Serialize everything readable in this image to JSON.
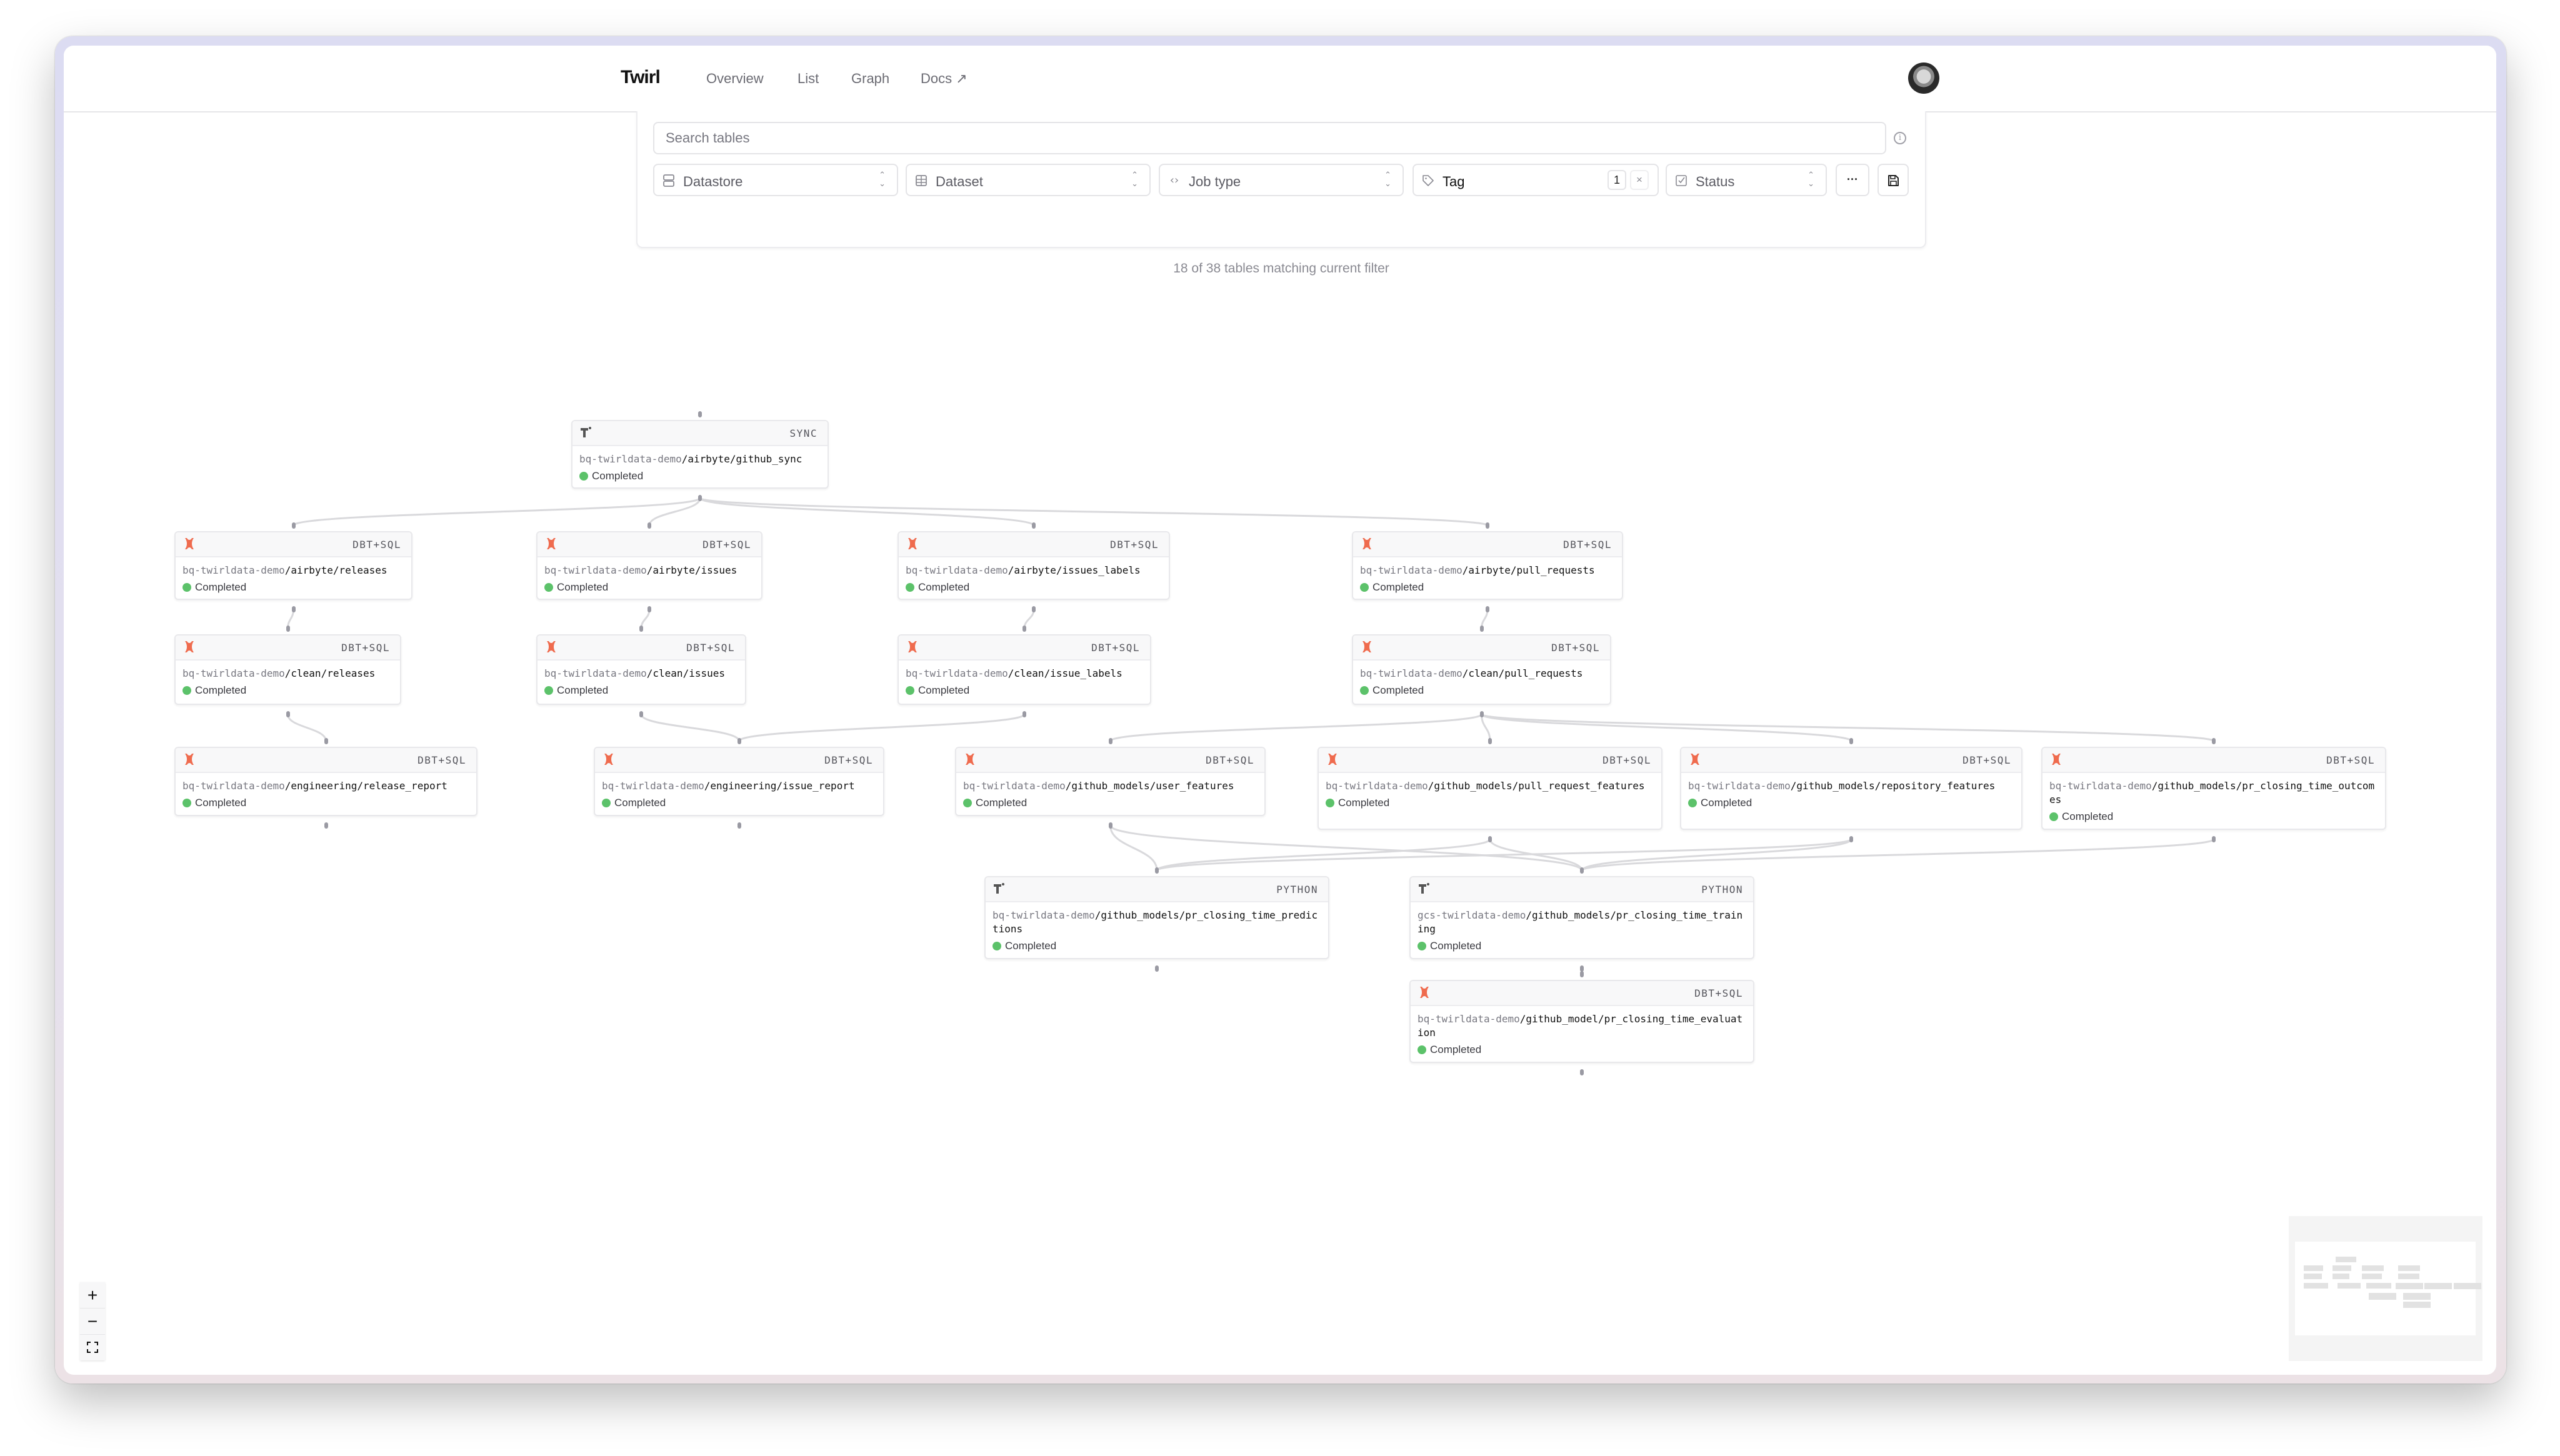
{
  "app": {
    "logo": "Twirl",
    "nav": [
      {
        "label": "Overview"
      },
      {
        "label": "List"
      },
      {
        "label": "Graph"
      },
      {
        "label": "Docs ↗"
      }
    ],
    "avatar_alt": "user avatar"
  },
  "filters": {
    "search_placeholder": "Search tables",
    "search_value": "",
    "datastore": {
      "label": "Datastore",
      "icon": "database-icon"
    },
    "dataset": {
      "label": "Dataset",
      "icon": "table-grid-icon"
    },
    "job_type": {
      "label": "Job type",
      "icon": "code-brackets-icon"
    },
    "tag": {
      "label": "Tag",
      "icon": "tag-icon",
      "count": "1",
      "clear": "×"
    },
    "status": {
      "label": "Status",
      "icon": "checkbox-icon"
    },
    "more": "···",
    "save_icon": "save-icon",
    "result_text": "18 of 38 tables matching current filter"
  },
  "graph": {
    "nodes": [
      {
        "id": "github_sync",
        "type": "SYNC",
        "icon": "airbyte-icon",
        "prefix": "bq-twirldata-demo",
        "path": "/airbyte/github_sync",
        "status": "Completed"
      },
      {
        "id": "airbyte_releases",
        "type": "DBT+SQL",
        "icon": "dbt-icon",
        "prefix": "bq-twirldata-demo",
        "path": "/airbyte/releases",
        "status": "Completed"
      },
      {
        "id": "airbyte_issues",
        "type": "DBT+SQL",
        "icon": "dbt-icon",
        "prefix": "bq-twirldata-demo",
        "path": "/airbyte/issues",
        "status": "Completed"
      },
      {
        "id": "airbyte_issues_labels",
        "type": "DBT+SQL",
        "icon": "dbt-icon",
        "prefix": "bq-twirldata-demo",
        "path": "/airbyte/issues_labels",
        "status": "Completed"
      },
      {
        "id": "airbyte_pull_requests",
        "type": "DBT+SQL",
        "icon": "dbt-icon",
        "prefix": "bq-twirldata-demo",
        "path": "/airbyte/pull_requests",
        "status": "Completed"
      },
      {
        "id": "clean_releases",
        "type": "DBT+SQL",
        "icon": "dbt-icon",
        "prefix": "bq-twirldata-demo",
        "path": "/clean/releases",
        "status": "Completed"
      },
      {
        "id": "clean_issues",
        "type": "DBT+SQL",
        "icon": "dbt-icon",
        "prefix": "bq-twirldata-demo",
        "path": "/clean/issues",
        "status": "Completed"
      },
      {
        "id": "clean_issue_labels",
        "type": "DBT+SQL",
        "icon": "dbt-icon",
        "prefix": "bq-twirldata-demo",
        "path": "/clean/issue_labels",
        "status": "Completed"
      },
      {
        "id": "clean_pull_requests",
        "type": "DBT+SQL",
        "icon": "dbt-icon",
        "prefix": "bq-twirldata-demo",
        "path": "/clean/pull_requests",
        "status": "Completed"
      },
      {
        "id": "release_report",
        "type": "DBT+SQL",
        "icon": "dbt-icon",
        "prefix": "bq-twirldata-demo",
        "path": "/engineering/release_report",
        "status": "Completed"
      },
      {
        "id": "issue_report",
        "type": "DBT+SQL",
        "icon": "dbt-icon",
        "prefix": "bq-twirldata-demo",
        "path": "/engineering/issue_report",
        "status": "Completed"
      },
      {
        "id": "user_features",
        "type": "DBT+SQL",
        "icon": "dbt-icon",
        "prefix": "bq-twirldata-demo",
        "path": "/github_models/user_features",
        "status": "Completed"
      },
      {
        "id": "pull_request_features",
        "type": "DBT+SQL",
        "icon": "dbt-icon",
        "prefix": "bq-twirldata-demo",
        "path": "/github_models/pull_request_features",
        "status": "Completed"
      },
      {
        "id": "repository_features",
        "type": "DBT+SQL",
        "icon": "dbt-icon",
        "prefix": "bq-twirldata-demo",
        "path": "/github_models/repository_features",
        "status": "Completed"
      },
      {
        "id": "pr_closing_time_outcomes",
        "type": "DBT+SQL",
        "icon": "dbt-icon",
        "prefix": "bq-twirldata-demo",
        "path": "/github_models/pr_closing_time_outcomes",
        "status": "Completed"
      },
      {
        "id": "pr_closing_time_predictions",
        "type": "PYTHON",
        "icon": "twirl-icon",
        "prefix": "bq-twirldata-demo",
        "path": "/github_models/pr_closing_time_predictions",
        "status": "Completed"
      },
      {
        "id": "pr_closing_time_training",
        "type": "PYTHON",
        "icon": "twirl-icon",
        "prefix": "gcs-twirldata-demo",
        "path": "/github_models/pr_closing_time_training",
        "status": "Completed"
      },
      {
        "id": "pr_closing_time_evaluation",
        "type": "DBT+SQL",
        "icon": "dbt-icon",
        "prefix": "bq-twirldata-demo",
        "path": "/github_model/pr_closing_time_evaluation",
        "status": "Completed"
      }
    ],
    "edges": [
      [
        "github_sync",
        "airbyte_releases"
      ],
      [
        "github_sync",
        "airbyte_issues"
      ],
      [
        "github_sync",
        "airbyte_issues_labels"
      ],
      [
        "github_sync",
        "airbyte_pull_requests"
      ],
      [
        "airbyte_releases",
        "clean_releases"
      ],
      [
        "airbyte_issues",
        "clean_issues"
      ],
      [
        "airbyte_issues_labels",
        "clean_issue_labels"
      ],
      [
        "airbyte_pull_requests",
        "clean_pull_requests"
      ],
      [
        "clean_releases",
        "release_report"
      ],
      [
        "clean_issues",
        "issue_report"
      ],
      [
        "clean_issue_labels",
        "issue_report"
      ],
      [
        "clean_pull_requests",
        "user_features"
      ],
      [
        "clean_pull_requests",
        "pull_request_features"
      ],
      [
        "clean_pull_requests",
        "repository_features"
      ],
      [
        "clean_pull_requests",
        "pr_closing_time_outcomes"
      ],
      [
        "user_features",
        "pr_closing_time_predictions"
      ],
      [
        "pull_request_features",
        "pr_closing_time_predictions"
      ],
      [
        "repository_features",
        "pr_closing_time_predictions"
      ],
      [
        "user_features",
        "pr_closing_time_training"
      ],
      [
        "pull_request_features",
        "pr_closing_time_training"
      ],
      [
        "repository_features",
        "pr_closing_time_training"
      ],
      [
        "pr_closing_time_outcomes",
        "pr_closing_time_training"
      ],
      [
        "pr_closing_time_training",
        "pr_closing_time_evaluation"
      ]
    ],
    "status_color": "#5cc26a",
    "dbt_color": "#ef6b4e"
  },
  "controls": {
    "zoom_in": "+",
    "zoom_out": "−",
    "fit_view": "⛶"
  }
}
